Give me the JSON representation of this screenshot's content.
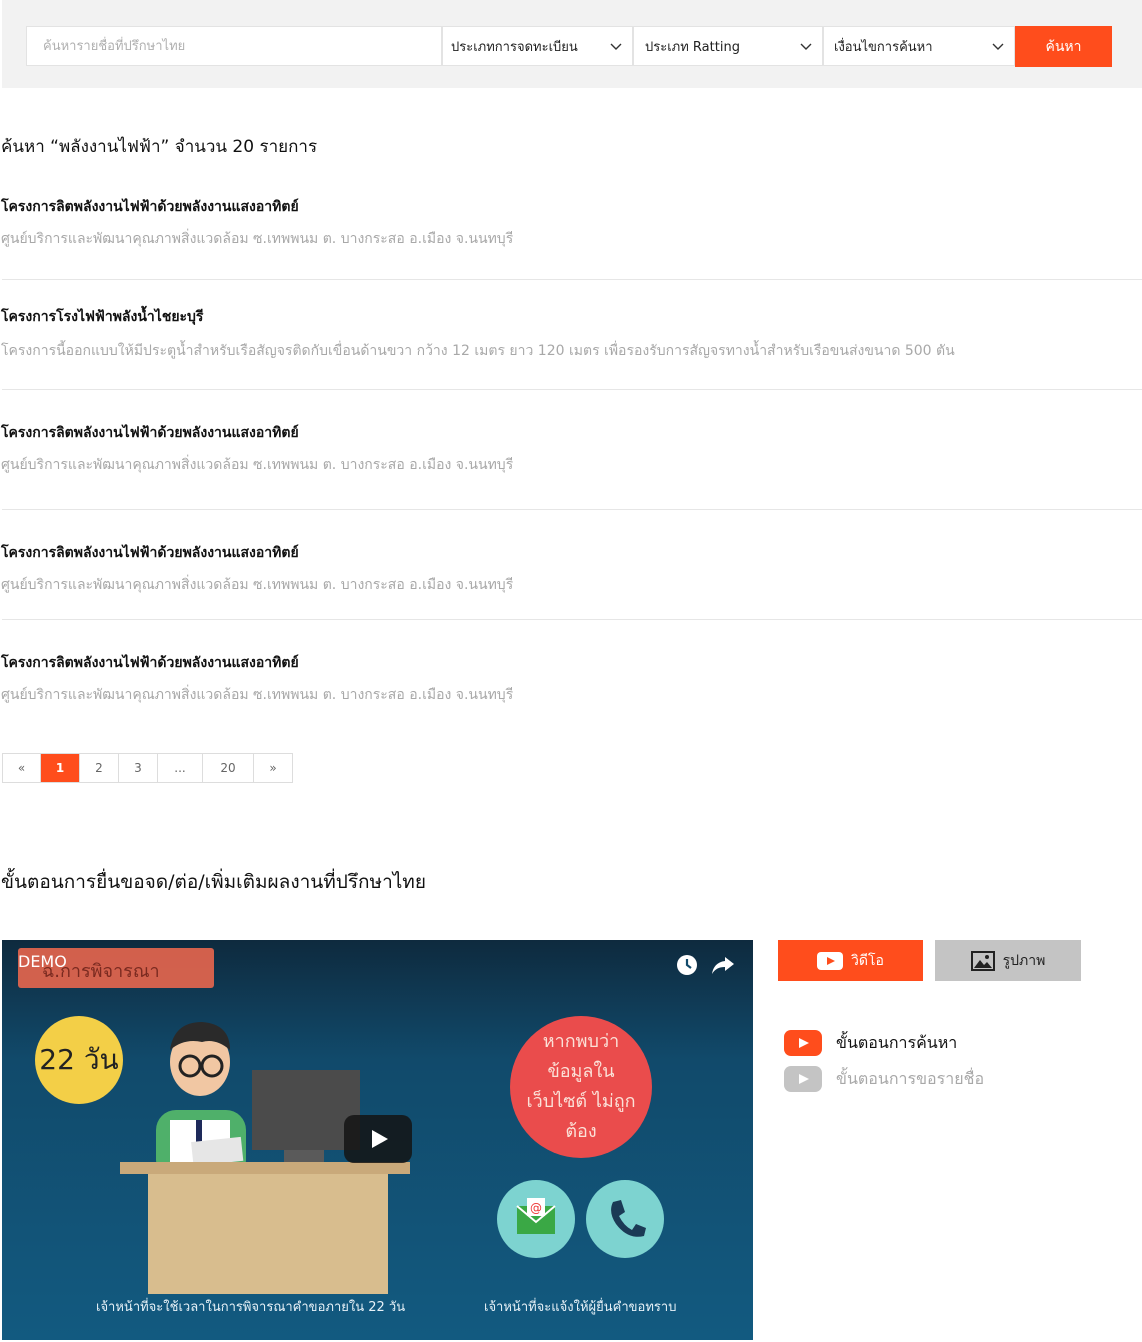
{
  "search": {
    "placeholder": "ค้นหารายชื่อที่ปรึกษาไทย",
    "filter_registration": "ประเภทการจดทะเบียน",
    "filter_rating": "ประเภท Ratting",
    "filter_condition": "เงื่อนไขการค้นหา",
    "button_label": "ค้นหา"
  },
  "results": {
    "heading": "ค้นหา “พลังงานไฟฟ้า” จำนวน 20 รายการ",
    "items": [
      {
        "title": "โครงการลิตพลังงานไฟฟ้าด้วยพลังงานแสงอาทิตย์",
        "desc": "ศูนย์บริการและพัฒนาคุณภาพสิ่งแวดล้อม ซ.เทพพนม ต. บางกระสอ อ.เมือง จ.นนทบุรี"
      },
      {
        "title": "โครงการโรงไฟฟ้าพลังน้ำไชยะบุรี",
        "desc": "โครงการนี้ออกแบบให้มีประตูน้ำสำหรับเรือสัญจรติดกับเขื่อนด้านขวา กว้าง 12 เมตร ยาว 120 เมตร เพื่อรองรับการสัญจรทางน้ำสำหรับเรือขนส่งขนาด 500 ตัน"
      },
      {
        "title": "โครงการลิตพลังงานไฟฟ้าด้วยพลังงานแสงอาทิตย์",
        "desc": "ศูนย์บริการและพัฒนาคุณภาพสิ่งแวดล้อม ซ.เทพพนม ต. บางกระสอ อ.เมือง จ.นนทบุรี"
      },
      {
        "title": "โครงการลิตพลังงานไฟฟ้าด้วยพลังงานแสงอาทิตย์",
        "desc": "ศูนย์บริการและพัฒนาคุณภาพสิ่งแวดล้อม ซ.เทพพนม ต. บางกระสอ อ.เมือง จ.นนทบุรี"
      },
      {
        "title": "โครงการลิตพลังงานไฟฟ้าด้วยพลังงานแสงอาทิตย์",
        "desc": "ศูนย์บริการและพัฒนาคุณภาพสิ่งแวดล้อม ซ.เทพพนม ต. บางกระสอ อ.เมือง จ.นนทบุรี"
      }
    ]
  },
  "pagination": {
    "prev": "«",
    "pages": [
      "1",
      "2",
      "3",
      "...",
      "20"
    ],
    "next": "»",
    "current": "1"
  },
  "process": {
    "title": "ขั้นตอนการยื่นขอจด/ต่อ/เพิ่มเติมผลงานที่ปรึกษาไทย",
    "video": {
      "demo_label": "DEMO",
      "banner_text": "ฉ.การพิจารณา",
      "days": "22 วัน",
      "bubble_text": "หากพบว่า ข้อมูลในเว็บไซต์ ไม่ถูกต้อง",
      "caption_left": "เจ้าหน้าที่จะใช้เวลาในการพิจารณาคำขอภายใน 22 วัน",
      "caption_right": "เจ้าหน้าที่จะแจ้งให้ผู้ยื่นคำขอทราบ"
    },
    "tabs": {
      "video": "วิดีโอ",
      "photo": "รูปภาพ"
    },
    "playlist": [
      {
        "label": "ขั้นตอนการค้นหา",
        "active": true
      },
      {
        "label": "ขั้นตอนการขอรายชื่อ",
        "active": false
      }
    ]
  },
  "colors": {
    "accent": "#ff4d1c",
    "muted": "#a8a8a8",
    "tab_inactive": "#c4c4c4"
  }
}
